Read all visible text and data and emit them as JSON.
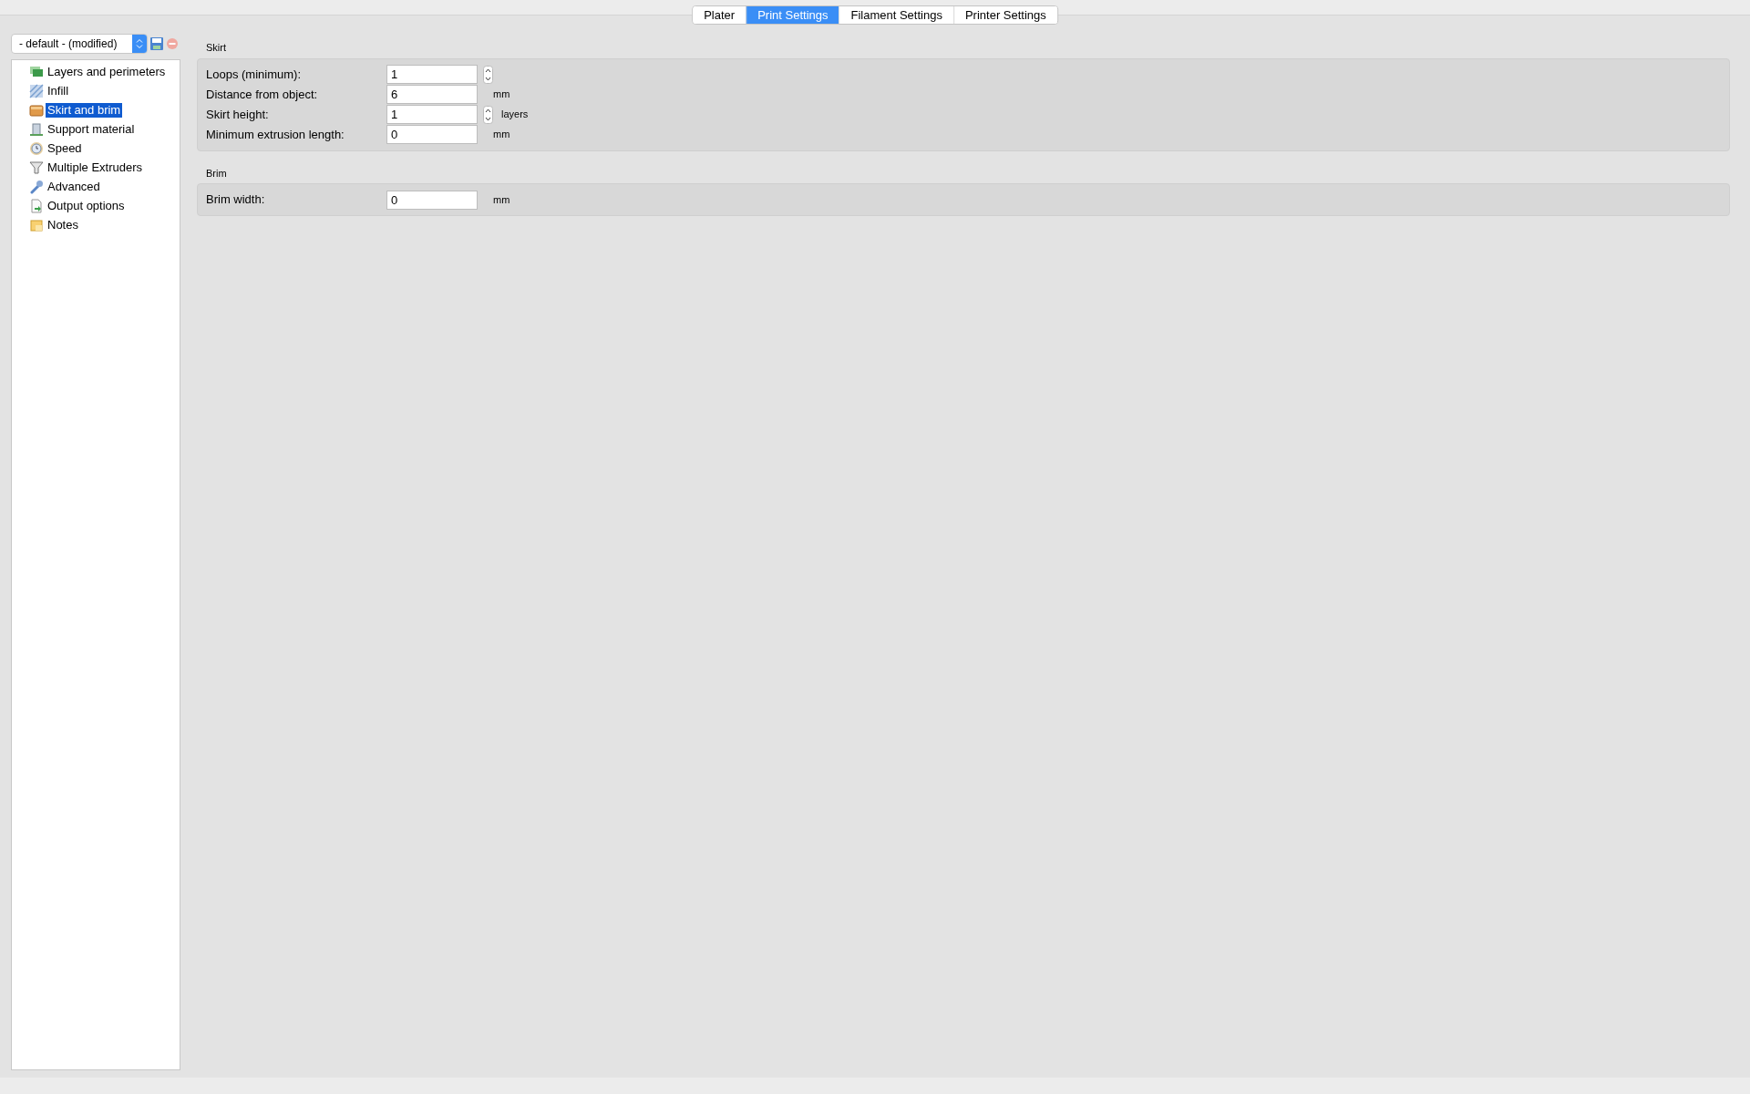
{
  "tabs": [
    {
      "label": "Plater",
      "selected": false
    },
    {
      "label": "Print Settings",
      "selected": true
    },
    {
      "label": "Filament Settings",
      "selected": false
    },
    {
      "label": "Printer Settings",
      "selected": false
    }
  ],
  "preset": {
    "value": "- default - (modified)"
  },
  "sidebar": {
    "items": [
      {
        "label": "Layers and perimeters",
        "kind": "layers",
        "selected": false
      },
      {
        "label": "Infill",
        "kind": "infill",
        "selected": false
      },
      {
        "label": "Skirt and brim",
        "kind": "box",
        "selected": true
      },
      {
        "label": "Support material",
        "kind": "building",
        "selected": false
      },
      {
        "label": "Speed",
        "kind": "clock",
        "selected": false
      },
      {
        "label": "Multiple Extruders",
        "kind": "funnel",
        "selected": false
      },
      {
        "label": "Advanced",
        "kind": "wrench",
        "selected": false
      },
      {
        "label": "Output options",
        "kind": "page",
        "selected": false
      },
      {
        "label": "Notes",
        "kind": "note",
        "selected": false
      }
    ]
  },
  "groups": [
    {
      "title": "Skirt",
      "fields": [
        {
          "label": "Loops (minimum):",
          "value": "1",
          "kind": "spin"
        },
        {
          "label": "Distance from object:",
          "value": "6",
          "kind": "plain",
          "unit": "mm"
        },
        {
          "label": "Skirt height:",
          "value": "1",
          "kind": "spin",
          "unit": "layers"
        },
        {
          "label": "Minimum extrusion length:",
          "value": "0",
          "kind": "plain",
          "unit": "mm"
        }
      ]
    },
    {
      "title": "Brim",
      "fields": [
        {
          "label": "Brim width:",
          "value": "0",
          "kind": "plain",
          "unit": "mm"
        }
      ]
    }
  ]
}
